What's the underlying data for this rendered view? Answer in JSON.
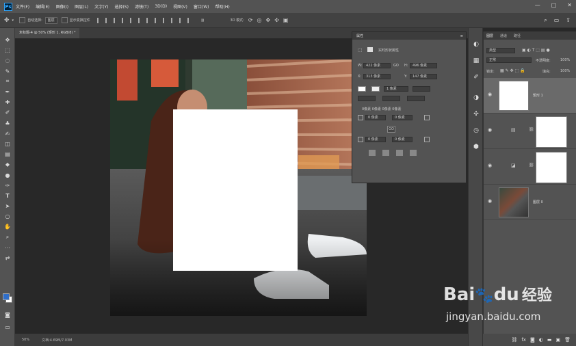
{
  "app": {
    "logo": "Ps",
    "menu": [
      "文件(F)",
      "编辑(E)",
      "图像(I)",
      "图层(L)",
      "文字(Y)",
      "选择(S)",
      "滤镜(T)",
      "3D(D)",
      "视图(V)",
      "窗口(W)",
      "帮助(H)"
    ],
    "window_controls": [
      "—",
      "□",
      "✕"
    ]
  },
  "options_bar": {
    "auto_select_label": "自动选择:",
    "auto_select_value": "图层",
    "show_transform_label": "显示变换控件",
    "mode_label": "3D 模式:"
  },
  "document": {
    "tab_title": "未标题-4 @ 50% (矩形 1, RGB/8) *",
    "zoom": "50%",
    "doc_size": "文档:4.69M/7.03M"
  },
  "properties": {
    "panel_title": "属性",
    "section_title": "实时形状属性",
    "w_label": "W:",
    "w_value": "422 像素",
    "h_label": "H:",
    "h_value": "496 像素",
    "x_label": "X:",
    "x_value": "313 像素",
    "y_label": "Y:",
    "y_value": "147 像素",
    "stroke_width": "1 像素",
    "corner_summary": "0像素 0像素 0像素 0像素",
    "corner_tl": "0 像素",
    "corner_tr": "0 像素",
    "corner_bl": "0 像素",
    "corner_br": "0 像素",
    "link_icon_label": "GO"
  },
  "layers": {
    "tabs": [
      "图层",
      "通道",
      "路径"
    ],
    "kind_filter": "类型",
    "blend_mode": "正常",
    "opacity_label": "不透明度:",
    "opacity_value": "100%",
    "lock_label": "锁定:",
    "fill_label": "填充:",
    "fill_value": "100%",
    "items": [
      {
        "name": "矩形 1",
        "selected": true
      },
      {
        "name": "",
        "selected": false
      },
      {
        "name": "",
        "selected": false
      },
      {
        "name": "图层 0",
        "selected": false
      }
    ]
  },
  "watermark": {
    "brand_a": "Bai",
    "brand_b": "du",
    "brand_c": "经验",
    "url": "jingyan.baidu.com"
  },
  "colors": {
    "foreground": "#2f6ec9",
    "background": "#ffffff",
    "brand_red": "#e02b2b",
    "brand_blue": "#2f6ec9"
  }
}
